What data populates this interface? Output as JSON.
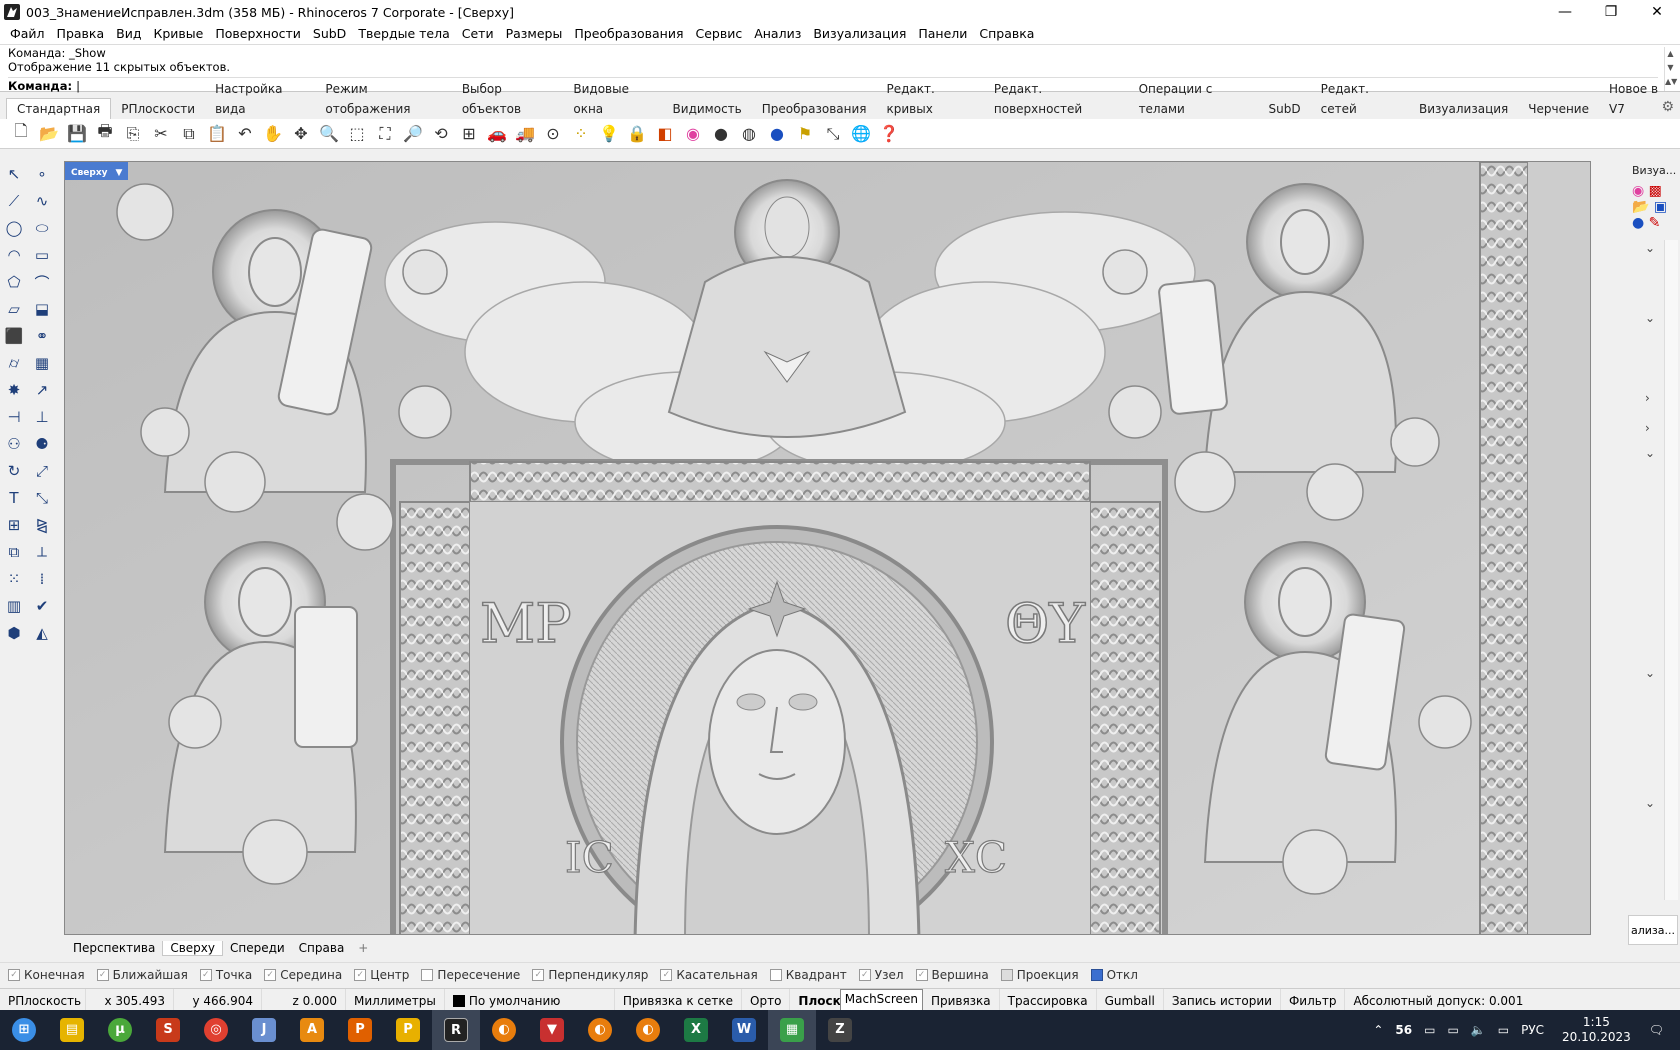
{
  "window": {
    "title": "003_ЗнамениеИсправлен.3dm (358 МБ) - Rhinoceros 7 Corporate - [Сверху]",
    "minimize": "—",
    "maximize": "❐",
    "close": "✕"
  },
  "menu": [
    "Файл",
    "Правка",
    "Вид",
    "Кривые",
    "Поверхности",
    "SubD",
    "Твердые тела",
    "Сети",
    "Размеры",
    "Преобразования",
    "Сервис",
    "Анализ",
    "Визуализация",
    "Панели",
    "Справка"
  ],
  "command": {
    "history": [
      "Команда: _Show",
      "Отображение 11 скрытых объектов."
    ],
    "prompt": "Команда:"
  },
  "toolbar_tabs": [
    "Стандартная",
    "РПлоскости",
    "Настройка вида",
    "Режим отображения",
    "Выбор объектов",
    "Видовые окна",
    "Видимость",
    "Преобразования",
    "Редакт. кривых",
    "Редакт. поверхностей",
    "Операции с телами",
    "SubD",
    "Редакт. сетей",
    "Визуализация",
    "Черчение",
    "Новое в V7"
  ],
  "active_tab": "Стандартная",
  "viewport": {
    "label": "Сверху",
    "icon_labels": [
      "ІС",
      "ХС"
    ]
  },
  "right_panel": {
    "label": "Визуа...",
    "bottom_label": "ализа..."
  },
  "view_tabs": [
    "Перспектива",
    "Сверху",
    "Спереди",
    "Справа",
    "+"
  ],
  "active_view": "Сверху",
  "osnaps": [
    {
      "label": "Конечная",
      "checked": false
    },
    {
      "label": "Ближайшая",
      "checked": false
    },
    {
      "label": "Точка",
      "checked": false
    },
    {
      "label": "Середина",
      "checked": false
    },
    {
      "label": "Центр",
      "checked": false
    },
    {
      "label": "Пересечение",
      "checked": false
    },
    {
      "label": "Перпендикуляр",
      "checked": false
    },
    {
      "label": "Касательная",
      "checked": false
    },
    {
      "label": "Квадрант",
      "checked": false
    },
    {
      "label": "Узел",
      "checked": false
    },
    {
      "label": "Вершина",
      "checked": false
    },
    {
      "label": "Проекция",
      "checked": false
    },
    {
      "label": "Откл",
      "checked": true
    }
  ],
  "status": {
    "cplane": "РПлоскость",
    "x": "x 305.493",
    "y": "y 466.904",
    "z": "z 0.000",
    "units": "Миллиметры",
    "layer": "По умолчанию",
    "grid_snap": "Привязка к сетке",
    "ortho": "Орто",
    "planar": "Плоск",
    "tooltip": "MachScreen",
    "osnap": "Привязка",
    "smarttrack": "Трассировка",
    "gumball": "Gumball",
    "record_history": "Запись истории",
    "filter": "Фильтр",
    "tolerance": "Абсолютный допуск: 0.001"
  },
  "taskbar": {
    "apps": [
      "start",
      "explorer",
      "utorrent",
      "app-red",
      "chrome",
      "app-blue",
      "app-a",
      "app-p",
      "app-p2",
      "rhino",
      "blender",
      "app-dl",
      "blender2",
      "blender3",
      "excel",
      "word",
      "app-green",
      "app-zbrush"
    ],
    "tray": {
      "temp": "56",
      "lang": "РУС",
      "time": "1:15",
      "date": "20.10.2023"
    }
  }
}
